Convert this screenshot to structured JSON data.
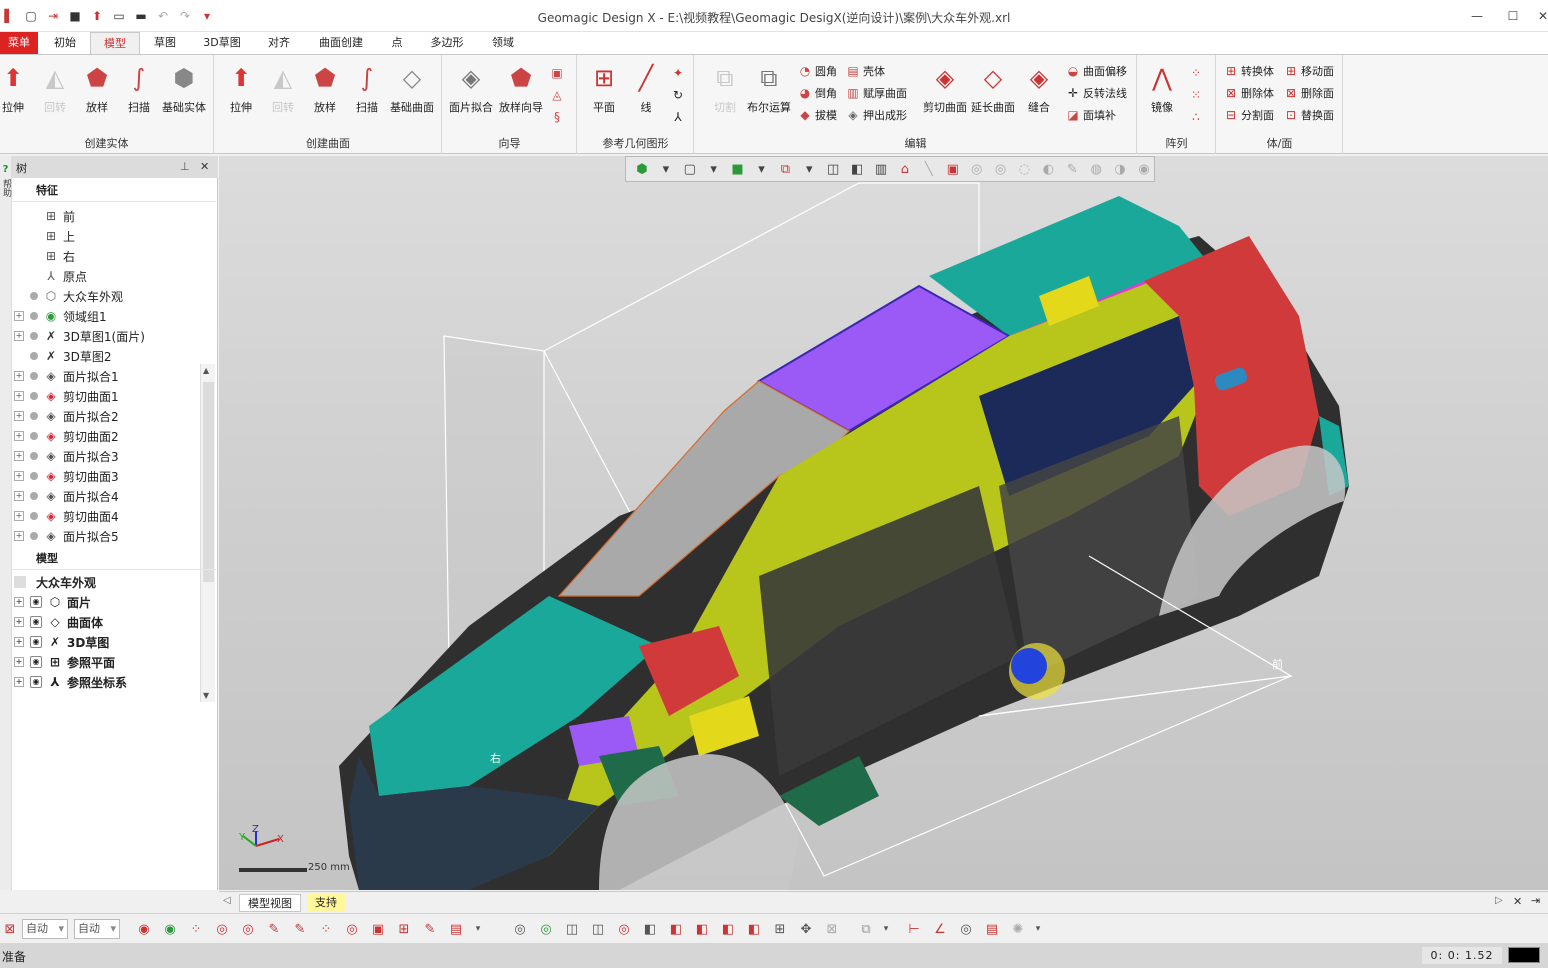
{
  "window": {
    "title": "Geomagic Design X - E:\\视频教程\\Geomagic DesigX(逆向设计)\\案例\\大众车外观.xrl",
    "quick_access": [
      "new-icon",
      "open-icon",
      "save-icon",
      "import-icon",
      "export-icon",
      "folder-icon",
      "undo-icon",
      "redo-icon",
      "dropdown-icon"
    ]
  },
  "ribbon": {
    "tabs": [
      "菜单",
      "初始",
      "模型",
      "草图",
      "3D草图",
      "对齐",
      "曲面创建",
      "点",
      "多边形",
      "领域"
    ],
    "active_tab": "模型",
    "groups": {
      "create_solid": {
        "label": "创建实体",
        "buttons": [
          "拉伸",
          "回转",
          "放样",
          "扫描",
          "基础实体"
        ]
      },
      "create_surface": {
        "label": "创建曲面",
        "buttons": [
          "拉伸",
          "回转",
          "放样",
          "扫描",
          "基础曲面"
        ]
      },
      "wizard": {
        "label": "向导",
        "buttons": [
          "面片拟合",
          "放样向导"
        ]
      },
      "ref_geometry": {
        "label": "参考几何图形",
        "buttons": [
          "平面",
          "线"
        ]
      },
      "edit": {
        "label": "编辑",
        "big": [
          "切割",
          "布尔运算",
          "剪切曲面",
          "延长曲面",
          "缝合"
        ],
        "small": [
          "圆角",
          "倒角",
          "拔模",
          "壳体",
          "赋厚曲面",
          "押出成形",
          "曲面偏移",
          "反转法线",
          "面填补"
        ]
      },
      "pattern": {
        "label": "阵列",
        "buttons": [
          "镜像"
        ]
      },
      "body_face": {
        "label": "体/面",
        "small": [
          "转换体",
          "删除体",
          "分割面",
          "移动面",
          "删除面",
          "替换面"
        ]
      }
    }
  },
  "tree_panel": {
    "title": "树",
    "pin_icon": "pin-icon",
    "features_header": "特征",
    "features": [
      {
        "label": "前",
        "icon": "plane-icon",
        "expand": false,
        "dot": false
      },
      {
        "label": "上",
        "icon": "plane-icon",
        "expand": false,
        "dot": false
      },
      {
        "label": "右",
        "icon": "plane-icon",
        "expand": false,
        "dot": false
      },
      {
        "label": "原点",
        "icon": "axis-icon",
        "expand": false,
        "dot": false
      },
      {
        "label": "大众车外观",
        "icon": "mesh-icon",
        "expand": false,
        "dot": true
      },
      {
        "label": "领域组1",
        "icon": "region-icon",
        "expand": true,
        "dot": true
      },
      {
        "label": "3D草图1(面片)",
        "icon": "sketch3d-icon",
        "expand": true,
        "dot": true
      },
      {
        "label": "3D草图2",
        "icon": "sketch3d-icon",
        "expand": false,
        "dot": true
      },
      {
        "label": "面片拟合1",
        "icon": "mesh-fit-icon",
        "expand": true,
        "dot": true
      },
      {
        "label": "剪切曲面1",
        "icon": "trim-surface-icon",
        "expand": true,
        "dot": true
      },
      {
        "label": "面片拟合2",
        "icon": "mesh-fit-icon",
        "expand": true,
        "dot": true
      },
      {
        "label": "剪切曲面2",
        "icon": "trim-surface-icon",
        "expand": true,
        "dot": true
      },
      {
        "label": "面片拟合3",
        "icon": "mesh-fit-icon",
        "expand": true,
        "dot": true
      },
      {
        "label": "剪切曲面3",
        "icon": "trim-surface-icon",
        "expand": true,
        "dot": true
      },
      {
        "label": "面片拟合4",
        "icon": "mesh-fit-icon",
        "expand": true,
        "dot": true
      },
      {
        "label": "剪切曲面4",
        "icon": "trim-surface-icon",
        "expand": true,
        "dot": true
      },
      {
        "label": "面片拟合5",
        "icon": "mesh-fit-icon",
        "expand": true,
        "dot": true
      }
    ],
    "model_header": "模型",
    "model_root": "大众车外观",
    "model_items": [
      "面片",
      "曲面体",
      "3D草图",
      "参照平面",
      "参照坐标系"
    ],
    "side_strip": "帮助"
  },
  "viewport": {
    "plane_labels": {
      "front": "前",
      "right": "右"
    },
    "scale_text": "250 mm",
    "axis": {
      "x": "X",
      "y": "Y",
      "z": "Z"
    }
  },
  "view_tabs": [
    "模型视图",
    "支持"
  ],
  "bottom": {
    "select1": "自动",
    "select2": "自动"
  },
  "status": {
    "text": "准备",
    "time": "0: 0: 1.52"
  },
  "colors": {
    "accent": "#d22222",
    "car_teal": "#1aa89a",
    "car_lime": "#b8c51a",
    "car_purple": "#9b59f5",
    "car_red": "#d13a3a",
    "car_navy": "#1c2a5a"
  }
}
